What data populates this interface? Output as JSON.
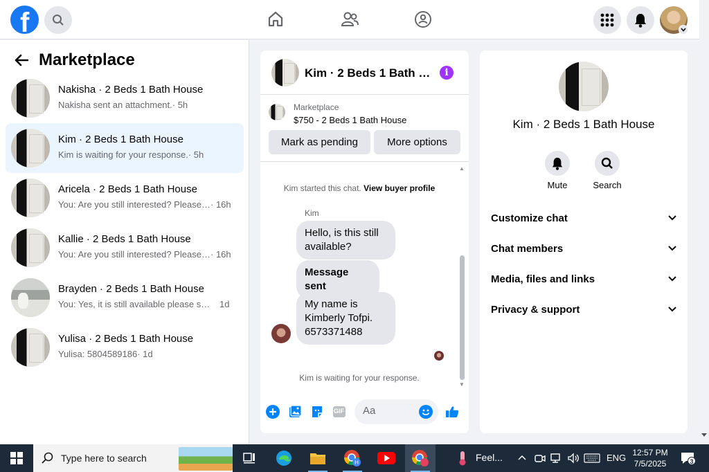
{
  "topbar": {
    "logo_letter": "f",
    "icons": {
      "search": "search-icon",
      "home": "home-icon",
      "friends": "friends-icon",
      "groups": "groups-icon",
      "menu": "grid-menu-icon",
      "notifications": "bell-icon",
      "account": "account-avatar"
    }
  },
  "sidebar": {
    "title": "Marketplace",
    "conversations": [
      {
        "title": "Nakisha · 2 Beds 1 Bath House",
        "preview": "Nakisha sent an attachment.",
        "time": " · 5h",
        "thumb": "door"
      },
      {
        "title": "Kim · 2 Beds 1 Bath House",
        "preview": "Kim is waiting for your response.",
        "time": " · 5h",
        "thumb": "door",
        "active": true
      },
      {
        "title": "Aricela · 2 Beds 1 Bath House",
        "preview": "You: Are you still interested? Please s...",
        "time": " · 16h",
        "thumb": "door"
      },
      {
        "title": "Kallie · 2 Beds 1 Bath House",
        "preview": "You: Are you still interested? Please s...",
        "time": " · 16h",
        "thumb": "door"
      },
      {
        "title": "Brayden · 2 Beds 1 Bath House",
        "preview": "You: Yes, it is still available please sen...",
        "time": "1d",
        "thumb": "bathroom"
      },
      {
        "title": "Yulisa · 2 Beds 1 Bath House",
        "preview": "Yulisa: 5804589186",
        "time": " · 1d",
        "thumb": "door"
      }
    ]
  },
  "chat": {
    "title": "Kim · 2 Beds 1 Bath House",
    "listing_label": "Marketplace",
    "listing_price": "$750 - 2 Beds 1 Bath House",
    "mark_pending": "Mark as pending",
    "more_options": "More options",
    "started_text": "Kim started this chat. ",
    "view_profile": "View buyer profile",
    "sender": "Kim",
    "messages": [
      "Hello, is this still available?",
      "Message sent",
      "My name is Kimberly Tofpi. 6573371488"
    ],
    "waiting": "Kim is waiting for your response.",
    "composer_placeholder": "Aa",
    "gif_label": "GIF"
  },
  "info_panel": {
    "name": "Kim · 2 Beds 1 Bath House",
    "actions": [
      {
        "label": "Mute",
        "icon": "bell-icon"
      },
      {
        "label": "Search",
        "icon": "search-icon"
      }
    ],
    "sections": [
      "Customize chat",
      "Chat members",
      "Media, files and links",
      "Privacy & support"
    ]
  },
  "taskbar": {
    "search_placeholder": "Type here to search",
    "weather_label": "Feel...",
    "language": "ENG",
    "time": "12:57 PM",
    "date": "7/5/2025",
    "notification_count": "3",
    "apps": [
      "task-view-icon",
      "edge-icon",
      "file-explorer-icon",
      "chrome-profile-h-icon",
      "youtube-icon",
      "chrome-profile-icon"
    ]
  },
  "colors": {
    "brand_blue": "#1877f2",
    "active_row": "#ebf5ff",
    "messenger_purple": "#a033ff",
    "composer_blue": "#0084ff",
    "taskbar": "#1c2a3a"
  }
}
